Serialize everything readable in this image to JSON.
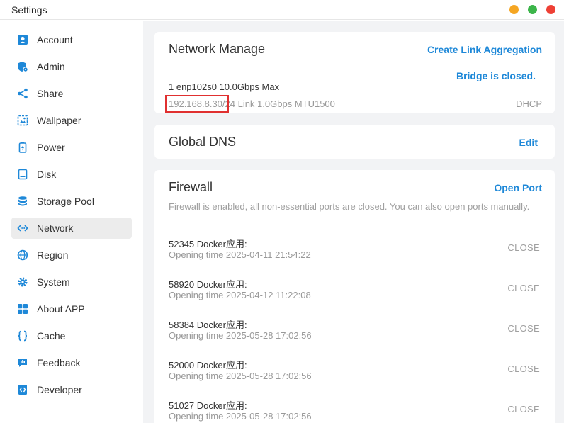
{
  "window": {
    "title": "Settings"
  },
  "colors": {
    "accent": "#1e88d8",
    "highlight": "#e03030",
    "sidebar_icon": "#1e88d8"
  },
  "sidebar": {
    "items": [
      {
        "label": "Account",
        "icon": "account-icon"
      },
      {
        "label": "Admin",
        "icon": "admin-icon"
      },
      {
        "label": "Share",
        "icon": "share-icon"
      },
      {
        "label": "Wallpaper",
        "icon": "wallpaper-icon"
      },
      {
        "label": "Power",
        "icon": "power-icon"
      },
      {
        "label": "Disk",
        "icon": "disk-icon"
      },
      {
        "label": "Storage Pool",
        "icon": "storage-pool-icon"
      },
      {
        "label": "Network",
        "icon": "network-icon",
        "active": true
      },
      {
        "label": "Region",
        "icon": "globe-icon"
      },
      {
        "label": "System",
        "icon": "gear-icon"
      },
      {
        "label": "About APP",
        "icon": "apps-icon"
      },
      {
        "label": "Cache",
        "icon": "braces-icon"
      },
      {
        "label": "Feedback",
        "icon": "feedback-icon"
      },
      {
        "label": "Developer",
        "icon": "developer-icon"
      }
    ]
  },
  "network_manage": {
    "title": "Network Manage",
    "action": "Create Link Aggregation",
    "nic_line": "1 enp102s0 10.0Gbps Max",
    "bridge_status": "Bridge is closed.",
    "ip_detail": "192.168.8.30/24 Link 1.0Gbps MTU1500",
    "mode": "DHCP"
  },
  "global_dns": {
    "title": "Global DNS",
    "action": "Edit"
  },
  "firewall": {
    "title": "Firewall",
    "action": "Open Port",
    "description": "Firewall is enabled, all non-essential ports are closed. You can also open ports manually.",
    "ports": [
      {
        "title": "52345  Docker应用:",
        "time": "Opening time 2025-04-11 21:54:22",
        "close": "CLOSE"
      },
      {
        "title": "58920  Docker应用:",
        "time": "Opening time 2025-04-12 11:22:08",
        "close": "CLOSE"
      },
      {
        "title": "58384  Docker应用:",
        "time": "Opening time 2025-05-28 17:02:56",
        "close": "CLOSE"
      },
      {
        "title": "52000  Docker应用:",
        "time": "Opening time 2025-05-28 17:02:56",
        "close": "CLOSE"
      },
      {
        "title": "51027  Docker应用:",
        "time": "Opening time 2025-05-28 17:02:56",
        "close": "CLOSE"
      }
    ]
  }
}
